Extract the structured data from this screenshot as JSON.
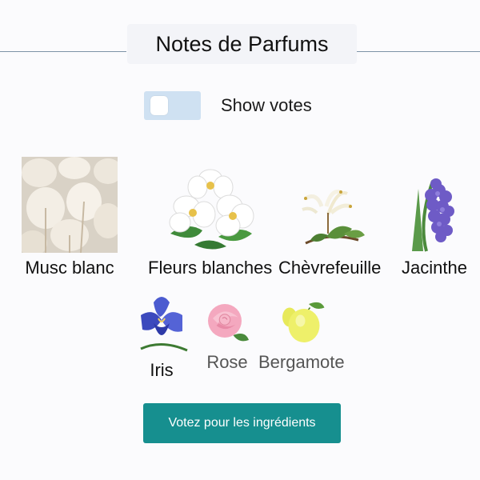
{
  "title": "Notes de Parfums",
  "toggle": {
    "label": "Show votes",
    "on": false
  },
  "notes": [
    {
      "label": "Musc blanc",
      "icon": "white-musk-bunny-tail-grass"
    },
    {
      "label": "Fleurs blanches",
      "icon": "white-jasmine-flowers"
    },
    {
      "label": "Chèvrefeuille",
      "icon": "honeysuckle-flower"
    },
    {
      "label": "Jacinthe",
      "icon": "purple-hyacinth"
    },
    {
      "label": "Iris",
      "icon": "blue-iris-flower"
    },
    {
      "label": "Rose",
      "icon": "pink-rose"
    },
    {
      "label": "Bergamote",
      "icon": "bergamot-fruit"
    }
  ],
  "vote_button": "Votez pour les ingrédients",
  "colors": {
    "accent": "#168f8f",
    "toggle_bg": "#cfe1f2",
    "rule": "#7d93a6"
  }
}
